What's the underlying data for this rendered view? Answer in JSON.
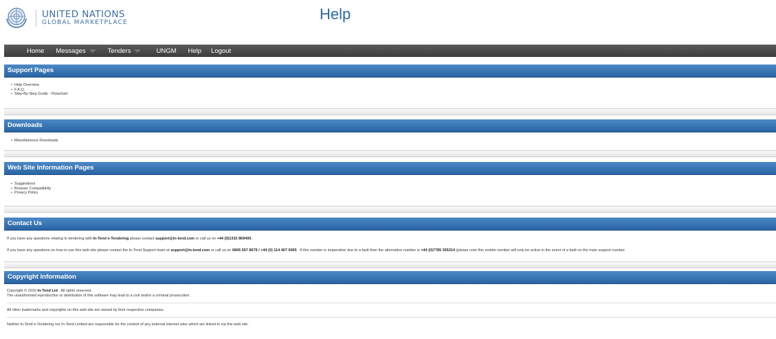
{
  "header": {
    "logo_line1": "UNITED NATIONS",
    "logo_line2": "GLOBAL MARKETPLACE",
    "title": "Help"
  },
  "nav": {
    "items": [
      "Home",
      "Messages",
      "Tenders",
      "UNGM",
      "Help",
      "Logout"
    ]
  },
  "support": {
    "title": "Support Pages",
    "links": [
      "Help Overview",
      "F.A.Q.",
      "Step-By-Step Guide - Flowchart"
    ]
  },
  "downloads": {
    "title": "Downloads",
    "links": [
      "Miscellaneous Downloads"
    ]
  },
  "website": {
    "title": "Web Site Information Pages",
    "links": [
      "Suggestions",
      "Browser Compatibility",
      "Privacy Policy"
    ]
  },
  "contact": {
    "title": "Contact Us",
    "p1_a": "If you have any questions relating to tendering with ",
    "p1_b": "In-Tend e-Tendering",
    "p1_c": " please contact ",
    "p1_d": "support@in-tend.com",
    "p1_e": " or call us on ",
    "p1_f": "+44 (0)1332 869400.",
    "p2_a": "If you have any questions on how to use this web site please contact the In-Tend Support team at ",
    "p2_b": "support@in-tend.com",
    "p2_c": " or call us on ",
    "p2_d": "0845 557 8079 / +44 (0) 114 407 0065",
    "p2_e": " . If this number is inoperative due to a fault then the alternative number is ",
    "p2_f": "+44 (0)7785 355314",
    "p2_g": " (please note this mobile number will only be active in the event of a fault on the main support number"
  },
  "copyright": {
    "title": "Copyright Information",
    "line1_a": "Copyright © 2015 ",
    "line1_b": "In-Tend Ltd",
    "line1_c": " . All rights reserved.",
    "line2": "The unauthorised reproduction or distribution of this software may lead to a civil and/or a criminal prosecution.",
    "line3": "All other trademarks and copyrights on this web site are owned by their respective companies.",
    "line4": "Neither In-Tend e-Tendering nor In-Tend Limited are responsible for the content of any external internet sites which are linked to via this web site."
  },
  "colors": {
    "accent": "#2a69a8",
    "nav_bg": "#444444",
    "section_head": "#3a78b8"
  }
}
